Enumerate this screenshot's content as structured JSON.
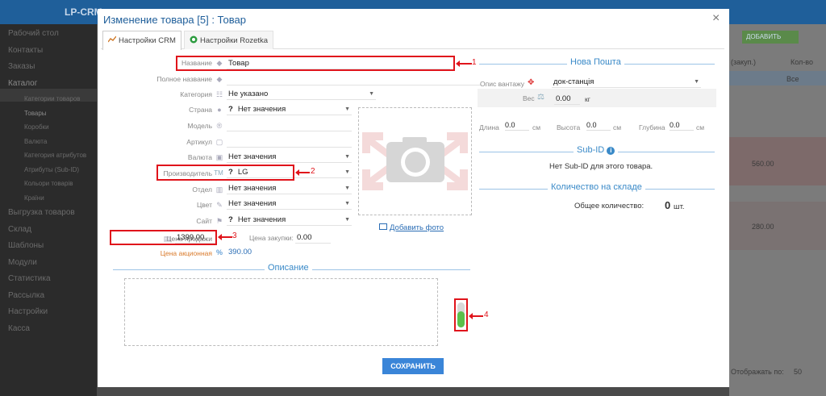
{
  "background": {
    "brand": "LP-CRM",
    "sidebar": [
      {
        "label": "Рабочий стол",
        "sub": false
      },
      {
        "label": "Контакты",
        "sub": false
      },
      {
        "label": "Заказы",
        "sub": false
      },
      {
        "label": "Каталог",
        "sub": false,
        "active": true
      },
      {
        "label": "Категории товаров",
        "sub": true
      },
      {
        "label": "Товары",
        "sub": true,
        "active": true
      },
      {
        "label": "Коробки",
        "sub": true
      },
      {
        "label": "Валюта",
        "sub": true
      },
      {
        "label": "Категория атрибутов",
        "sub": true
      },
      {
        "label": "Атрибуты (Sub-ID)",
        "sub": true
      },
      {
        "label": "Кольори товарів",
        "sub": true
      },
      {
        "label": "Країни",
        "sub": true
      },
      {
        "label": "Выгрузка товаров",
        "sub": false
      },
      {
        "label": "Склад",
        "sub": false
      },
      {
        "label": "Шаблоны",
        "sub": false
      },
      {
        "label": "Модули",
        "sub": false
      },
      {
        "label": "Статистика",
        "sub": false
      },
      {
        "label": "Рассылка",
        "sub": false
      },
      {
        "label": "Настройки",
        "sub": false
      },
      {
        "label": "Касса",
        "sub": false
      }
    ],
    "right": {
      "add_button": "ДОБАВИТЬ",
      "col_zakup": "(закуп.)",
      "col_kolvo": "Кол-во",
      "col_all": "Все",
      "val1": "560.00",
      "val2": "280.00",
      "footer": "Отображать по:",
      "per_page": "50"
    }
  },
  "modal": {
    "title": "Изменение товара [5] : Товар",
    "close": "×",
    "tabs": [
      {
        "label": "Настройки CRM",
        "active": true
      },
      {
        "label": "Настройки Rozetka",
        "active": false
      }
    ],
    "fields": {
      "name_label": "Название",
      "name_value": "Товар",
      "fullname_label": "Полное название",
      "fullname_value": "",
      "category_label": "Категория",
      "category_value": "Не указано",
      "country_label": "Страна",
      "country_value": "Нет значения",
      "model_label": "Модель",
      "article_label": "Артикул",
      "currency_label": "Валюта",
      "currency_value": "Нет значения",
      "manufacturer_label": "Производитель",
      "manufacturer_value": "LG",
      "department_label": "Отдел",
      "department_value": "Нет значения",
      "color_label": "Цвет",
      "color_value": "Нет значения",
      "site_label": "Сайт",
      "site_value": "Нет значения",
      "sale_price_label": "Цена продажи",
      "sale_price_value": "1399.00",
      "purchase_price_label": "Цена закупки:",
      "purchase_price_value": "0.00",
      "promo_price_label": "Цена акционная",
      "promo_price_value": "390.00"
    },
    "add_photo": "Добавить фото",
    "description_title": "Описание",
    "save": "СОХРАНИТЬ",
    "np": {
      "title": "Нова Пошта",
      "cargo_label": "Опис вантажу",
      "cargo_value": "док-станція",
      "weight_label": "Вес",
      "weight_value": "0.00",
      "weight_unit": "кг",
      "length_label": "Длина",
      "length_value": "0.0",
      "height_label": "Высота",
      "height_value": "0.0",
      "depth_label": "Глубина",
      "depth_value": "0.0",
      "unit": "см"
    },
    "subid": {
      "title": "Sub-ID",
      "empty": "Нет Sub-ID для этого товара."
    },
    "stock": {
      "title": "Количество на складе",
      "total_label": "Общее количество:",
      "total_value": "0",
      "unit": "шт."
    },
    "annotations": [
      "1",
      "2",
      "3",
      "4"
    ],
    "toggle_level": 0.65
  },
  "colors": {
    "accent": "#3a85d8",
    "title": "#1e5e9a",
    "annotation": "#e0141b",
    "toggle_on": "#5cc04a"
  }
}
